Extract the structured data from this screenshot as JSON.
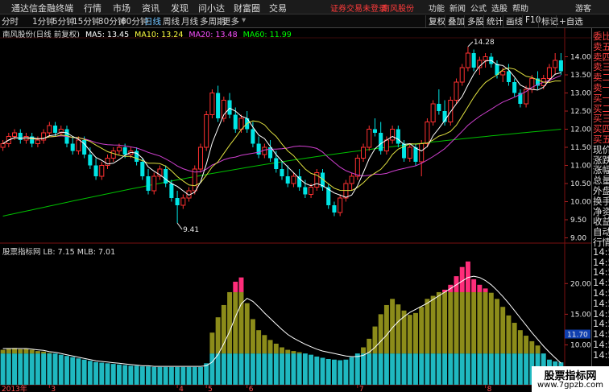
{
  "window": {
    "app_name": "通达信金融终端",
    "menu": [
      "行情",
      "市场",
      "资讯",
      "发现",
      "问小达",
      "财富圈",
      "交易"
    ],
    "alert": "证券交易未登录",
    "stock_link": "南风股份",
    "right_menu": [
      "功能",
      "新闻",
      "公式",
      "选股",
      "帮助"
    ],
    "user": "游客"
  },
  "toolbar": {
    "periods": [
      "分时",
      "1分钟",
      "5分钟",
      "15分钟",
      "30分钟",
      "60分钟",
      "日线",
      "周线",
      "月线",
      "多周期",
      "更多"
    ],
    "active_period": "日线",
    "right_buttons": [
      "复权",
      "叠加",
      "多股",
      "统计",
      "画线",
      "F10",
      "标记",
      "+自选"
    ]
  },
  "price_panel": {
    "title": "南风股份(日线 前复权)",
    "ma": [
      {
        "label": "MA5: 13.45",
        "color": "#ffffff"
      },
      {
        "label": "MA10: 13.24",
        "color": "#ffff40"
      },
      {
        "label": "MA20: 13.48",
        "color": "#ff50ff"
      },
      {
        "label": "MA60: 11.99",
        "color": "#00ff00"
      }
    ],
    "high_label": "14.28",
    "low_label": "9.41"
  },
  "indicator_panel": {
    "title": "股票指标网",
    "lb": "LB: 7.15",
    "mlb": "MLB: 7.01",
    "current_value": "11.70"
  },
  "sidebar": {
    "items": [
      "委比",
      "卖五",
      "卖四",
      "卖三",
      "卖二",
      "卖一",
      "买一",
      "买二",
      "买三",
      "买四",
      "买五",
      "现价",
      "涨跌",
      "涨幅",
      "总量",
      "外盘",
      "换手",
      "净资",
      "收益",
      "自动",
      "行情",
      "14:56",
      "14:56",
      "14:56",
      "14:56",
      "14:56",
      "14:56",
      "14:56",
      "14:56",
      "14:56",
      "14:56",
      "14:56"
    ]
  },
  "x_axis": {
    "year_label": "2013年",
    "month_labels": [
      "3",
      "4",
      "5",
      "6",
      "7",
      "8"
    ]
  },
  "watermark": {
    "line1": "股票指标网",
    "line2": "www.7gpzb.com"
  },
  "chart_data": [
    {
      "type": "candlestick",
      "title": "南风股份(日线 前复权)",
      "ylim": [
        8.9,
        14.5
      ],
      "y_ticks": [
        9.0,
        9.5,
        10.0,
        10.5,
        11.0,
        11.5,
        12.0,
        12.5,
        13.0,
        13.5,
        14.0
      ],
      "annotations": [
        {
          "text": "14.28",
          "value": 14.28
        },
        {
          "text": "9.41",
          "value": 9.41
        }
      ],
      "candles": [
        [
          11.5,
          11.7,
          11.4,
          11.6
        ],
        [
          11.6,
          11.9,
          11.5,
          11.8
        ],
        [
          11.8,
          12.0,
          11.7,
          11.9
        ],
        [
          11.9,
          12.0,
          11.6,
          11.7
        ],
        [
          11.7,
          11.9,
          11.6,
          11.8
        ],
        [
          11.8,
          11.9,
          11.5,
          11.6
        ],
        [
          11.6,
          11.8,
          11.5,
          11.7
        ],
        [
          11.7,
          12.0,
          11.6,
          11.9
        ],
        [
          11.9,
          12.2,
          11.8,
          12.1
        ],
        [
          12.1,
          12.2,
          11.8,
          11.9
        ],
        [
          11.9,
          12.1,
          11.8,
          12.0
        ],
        [
          12.0,
          12.1,
          11.5,
          11.6
        ],
        [
          11.6,
          11.8,
          11.3,
          11.4
        ],
        [
          11.4,
          11.8,
          11.3,
          11.7
        ],
        [
          11.7,
          11.8,
          11.2,
          11.3
        ],
        [
          11.3,
          11.5,
          10.9,
          11.0
        ],
        [
          11.0,
          11.2,
          10.6,
          10.7
        ],
        [
          10.7,
          11.1,
          10.6,
          11.0
        ],
        [
          11.0,
          11.3,
          10.9,
          11.2
        ],
        [
          11.2,
          11.5,
          11.1,
          11.4
        ],
        [
          11.4,
          11.6,
          11.3,
          11.5
        ],
        [
          11.5,
          11.6,
          11.2,
          11.3
        ],
        [
          11.3,
          11.5,
          11.2,
          11.4
        ],
        [
          11.4,
          11.5,
          11.0,
          11.1
        ],
        [
          11.1,
          11.2,
          10.6,
          10.7
        ],
        [
          10.7,
          10.9,
          10.2,
          10.3
        ],
        [
          10.3,
          10.8,
          10.2,
          10.7
        ],
        [
          10.7,
          11.0,
          10.6,
          10.9
        ],
        [
          10.9,
          11.0,
          10.4,
          10.5
        ],
        [
          10.5,
          10.6,
          10.0,
          10.1
        ],
        [
          10.1,
          10.3,
          9.41,
          9.9
        ],
        [
          9.9,
          10.2,
          9.8,
          10.1
        ],
        [
          10.1,
          10.4,
          10.0,
          10.3
        ],
        [
          10.3,
          11.0,
          10.2,
          10.9
        ],
        [
          10.9,
          11.6,
          10.8,
          11.5
        ],
        [
          11.5,
          12.5,
          11.4,
          12.4
        ],
        [
          12.4,
          13.1,
          12.3,
          13.0
        ],
        [
          13.0,
          13.2,
          12.2,
          12.3
        ],
        [
          12.3,
          12.9,
          12.2,
          12.8
        ],
        [
          12.8,
          13.0,
          12.3,
          12.4
        ],
        [
          12.4,
          12.6,
          11.9,
          12.0
        ],
        [
          12.0,
          12.4,
          11.9,
          12.3
        ],
        [
          12.3,
          12.5,
          11.9,
          12.0
        ],
        [
          12.0,
          12.2,
          11.5,
          11.6
        ],
        [
          11.6,
          11.8,
          11.2,
          11.3
        ],
        [
          11.3,
          11.6,
          11.2,
          11.5
        ],
        [
          11.5,
          11.7,
          11.1,
          11.2
        ],
        [
          11.2,
          11.4,
          10.8,
          10.9
        ],
        [
          10.9,
          11.1,
          10.6,
          10.7
        ],
        [
          10.7,
          11.0,
          10.4,
          10.5
        ],
        [
          10.5,
          10.8,
          10.4,
          10.7
        ],
        [
          10.7,
          10.9,
          10.3,
          10.4
        ],
        [
          10.4,
          10.6,
          10.1,
          10.2
        ],
        [
          10.2,
          10.5,
          10.1,
          10.4
        ],
        [
          10.4,
          10.9,
          10.3,
          10.8
        ],
        [
          10.8,
          10.9,
          10.3,
          10.4
        ],
        [
          10.4,
          10.5,
          9.8,
          9.9
        ],
        [
          9.9,
          10.0,
          9.6,
          9.7
        ],
        [
          9.7,
          10.2,
          9.6,
          10.1
        ],
        [
          10.1,
          10.6,
          10.0,
          10.5
        ],
        [
          10.5,
          10.8,
          10.3,
          10.7
        ],
        [
          10.7,
          11.3,
          10.6,
          11.2
        ],
        [
          11.2,
          11.6,
          11.1,
          11.5
        ],
        [
          11.5,
          12.1,
          11.4,
          12.0
        ],
        [
          12.0,
          12.3,
          11.8,
          11.9
        ],
        [
          11.9,
          12.2,
          11.3,
          11.4
        ],
        [
          11.4,
          11.8,
          11.3,
          11.7
        ],
        [
          11.7,
          12.1,
          11.6,
          12.0
        ],
        [
          12.0,
          12.1,
          11.5,
          11.6
        ],
        [
          11.6,
          11.7,
          11.1,
          11.2
        ],
        [
          11.2,
          11.6,
          11.1,
          11.5
        ],
        [
          11.5,
          11.6,
          11.0,
          11.1
        ],
        [
          11.1,
          11.7,
          10.7,
          11.6
        ],
        [
          11.6,
          12.3,
          11.5,
          12.2
        ],
        [
          12.2,
          12.8,
          12.1,
          12.7
        ],
        [
          12.7,
          13.1,
          12.4,
          12.5
        ],
        [
          12.5,
          12.8,
          12.1,
          12.2
        ],
        [
          12.2,
          12.9,
          12.1,
          12.8
        ],
        [
          12.8,
          13.4,
          12.7,
          13.3
        ],
        [
          13.3,
          13.8,
          13.2,
          13.7
        ],
        [
          13.7,
          14.28,
          13.6,
          14.1
        ],
        [
          14.1,
          14.2,
          13.6,
          13.7
        ],
        [
          13.7,
          14.0,
          13.5,
          13.9
        ],
        [
          13.9,
          14.1,
          13.7,
          14.0
        ],
        [
          14.0,
          14.1,
          13.7,
          13.8
        ],
        [
          13.8,
          13.9,
          13.4,
          13.5
        ],
        [
          13.5,
          13.7,
          13.3,
          13.6
        ],
        [
          13.6,
          13.8,
          13.2,
          13.3
        ],
        [
          13.3,
          13.4,
          12.9,
          13.0
        ],
        [
          13.0,
          13.1,
          12.6,
          12.7
        ],
        [
          12.7,
          13.2,
          12.6,
          13.1
        ],
        [
          13.1,
          13.5,
          13.0,
          13.4
        ],
        [
          13.4,
          13.6,
          13.1,
          13.2
        ],
        [
          13.2,
          13.5,
          13.1,
          13.4
        ],
        [
          13.4,
          13.8,
          13.3,
          13.7
        ],
        [
          13.7,
          14.1,
          13.5,
          13.9
        ],
        [
          13.9,
          14.1,
          13.5,
          13.6
        ]
      ]
    },
    {
      "type": "bar",
      "title": "股票指标网",
      "ylim": [
        3.5,
        24.5
      ],
      "y_ticks": [
        5.0,
        10.0,
        15.0,
        20.0
      ],
      "series": [
        {
          "name": "LB",
          "values": [
            9.2,
            9.4,
            9.5,
            9.3,
            9.4,
            9.2,
            9.0,
            8.9,
            8.7,
            8.6,
            8.4,
            8.2,
            8.0,
            7.8,
            7.6,
            7.4,
            7.2,
            7.1,
            7.0,
            6.9,
            6.8,
            6.7,
            6.6,
            6.6,
            6.5,
            6.5,
            6.4,
            6.4,
            6.4,
            6.4,
            6.4,
            6.4,
            6.4,
            6.4,
            6.4,
            7.0,
            12.0,
            14.5,
            16.5,
            18.6,
            20.3,
            21.0,
            16.8,
            14.2,
            12.4,
            11.6,
            10.8,
            10.2,
            9.6,
            9.2,
            9.0,
            8.8,
            8.6,
            8.4,
            8.1,
            7.9,
            7.7,
            7.6,
            7.5,
            7.6,
            8.0,
            8.6,
            9.6,
            11.0,
            13.0,
            15.0,
            16.5,
            17.5,
            16.6,
            15.6,
            14.9,
            15.2,
            16.2,
            17.5,
            18.0,
            18.6,
            19.0,
            19.8,
            21.2,
            22.7,
            23.6,
            20.7,
            19.8,
            19.2,
            18.5,
            17.5,
            16.2,
            14.8,
            13.6,
            12.4,
            11.5,
            10.6,
            9.9,
            8.6,
            7.6,
            7.3,
            7.15
          ]
        },
        {
          "name": "MLB",
          "values": [
            9.4,
            9.4,
            9.4,
            9.4,
            9.4,
            9.3,
            9.2,
            9.1,
            8.9,
            8.8,
            8.6,
            8.4,
            8.2,
            8.0,
            7.8,
            7.6,
            7.4,
            7.3,
            7.2,
            7.1,
            7.0,
            6.9,
            6.8,
            6.7,
            6.6,
            6.6,
            6.5,
            6.5,
            6.5,
            6.5,
            6.5,
            6.5,
            6.5,
            6.5,
            6.5,
            6.6,
            7.2,
            8.4,
            10.2,
            12.2,
            14.6,
            16.7,
            17.6,
            17.1,
            16.2,
            15.2,
            14.3,
            13.4,
            12.5,
            11.7,
            11.1,
            10.6,
            10.1,
            9.7,
            9.3,
            9.0,
            8.8,
            8.6,
            8.4,
            8.2,
            8.1,
            8.1,
            8.3,
            8.8,
            9.6,
            10.6,
            11.6,
            12.8,
            13.8,
            14.6,
            15.3,
            15.8,
            16.3,
            16.8,
            17.4,
            18.0,
            18.6,
            19.2,
            19.8,
            20.4,
            21.0,
            21.2,
            21.0,
            20.5,
            19.8,
            18.9,
            17.9,
            16.8,
            15.6,
            14.4,
            13.2,
            12.0,
            10.9,
            9.8,
            8.8,
            7.9,
            7.01
          ]
        }
      ]
    }
  ]
}
